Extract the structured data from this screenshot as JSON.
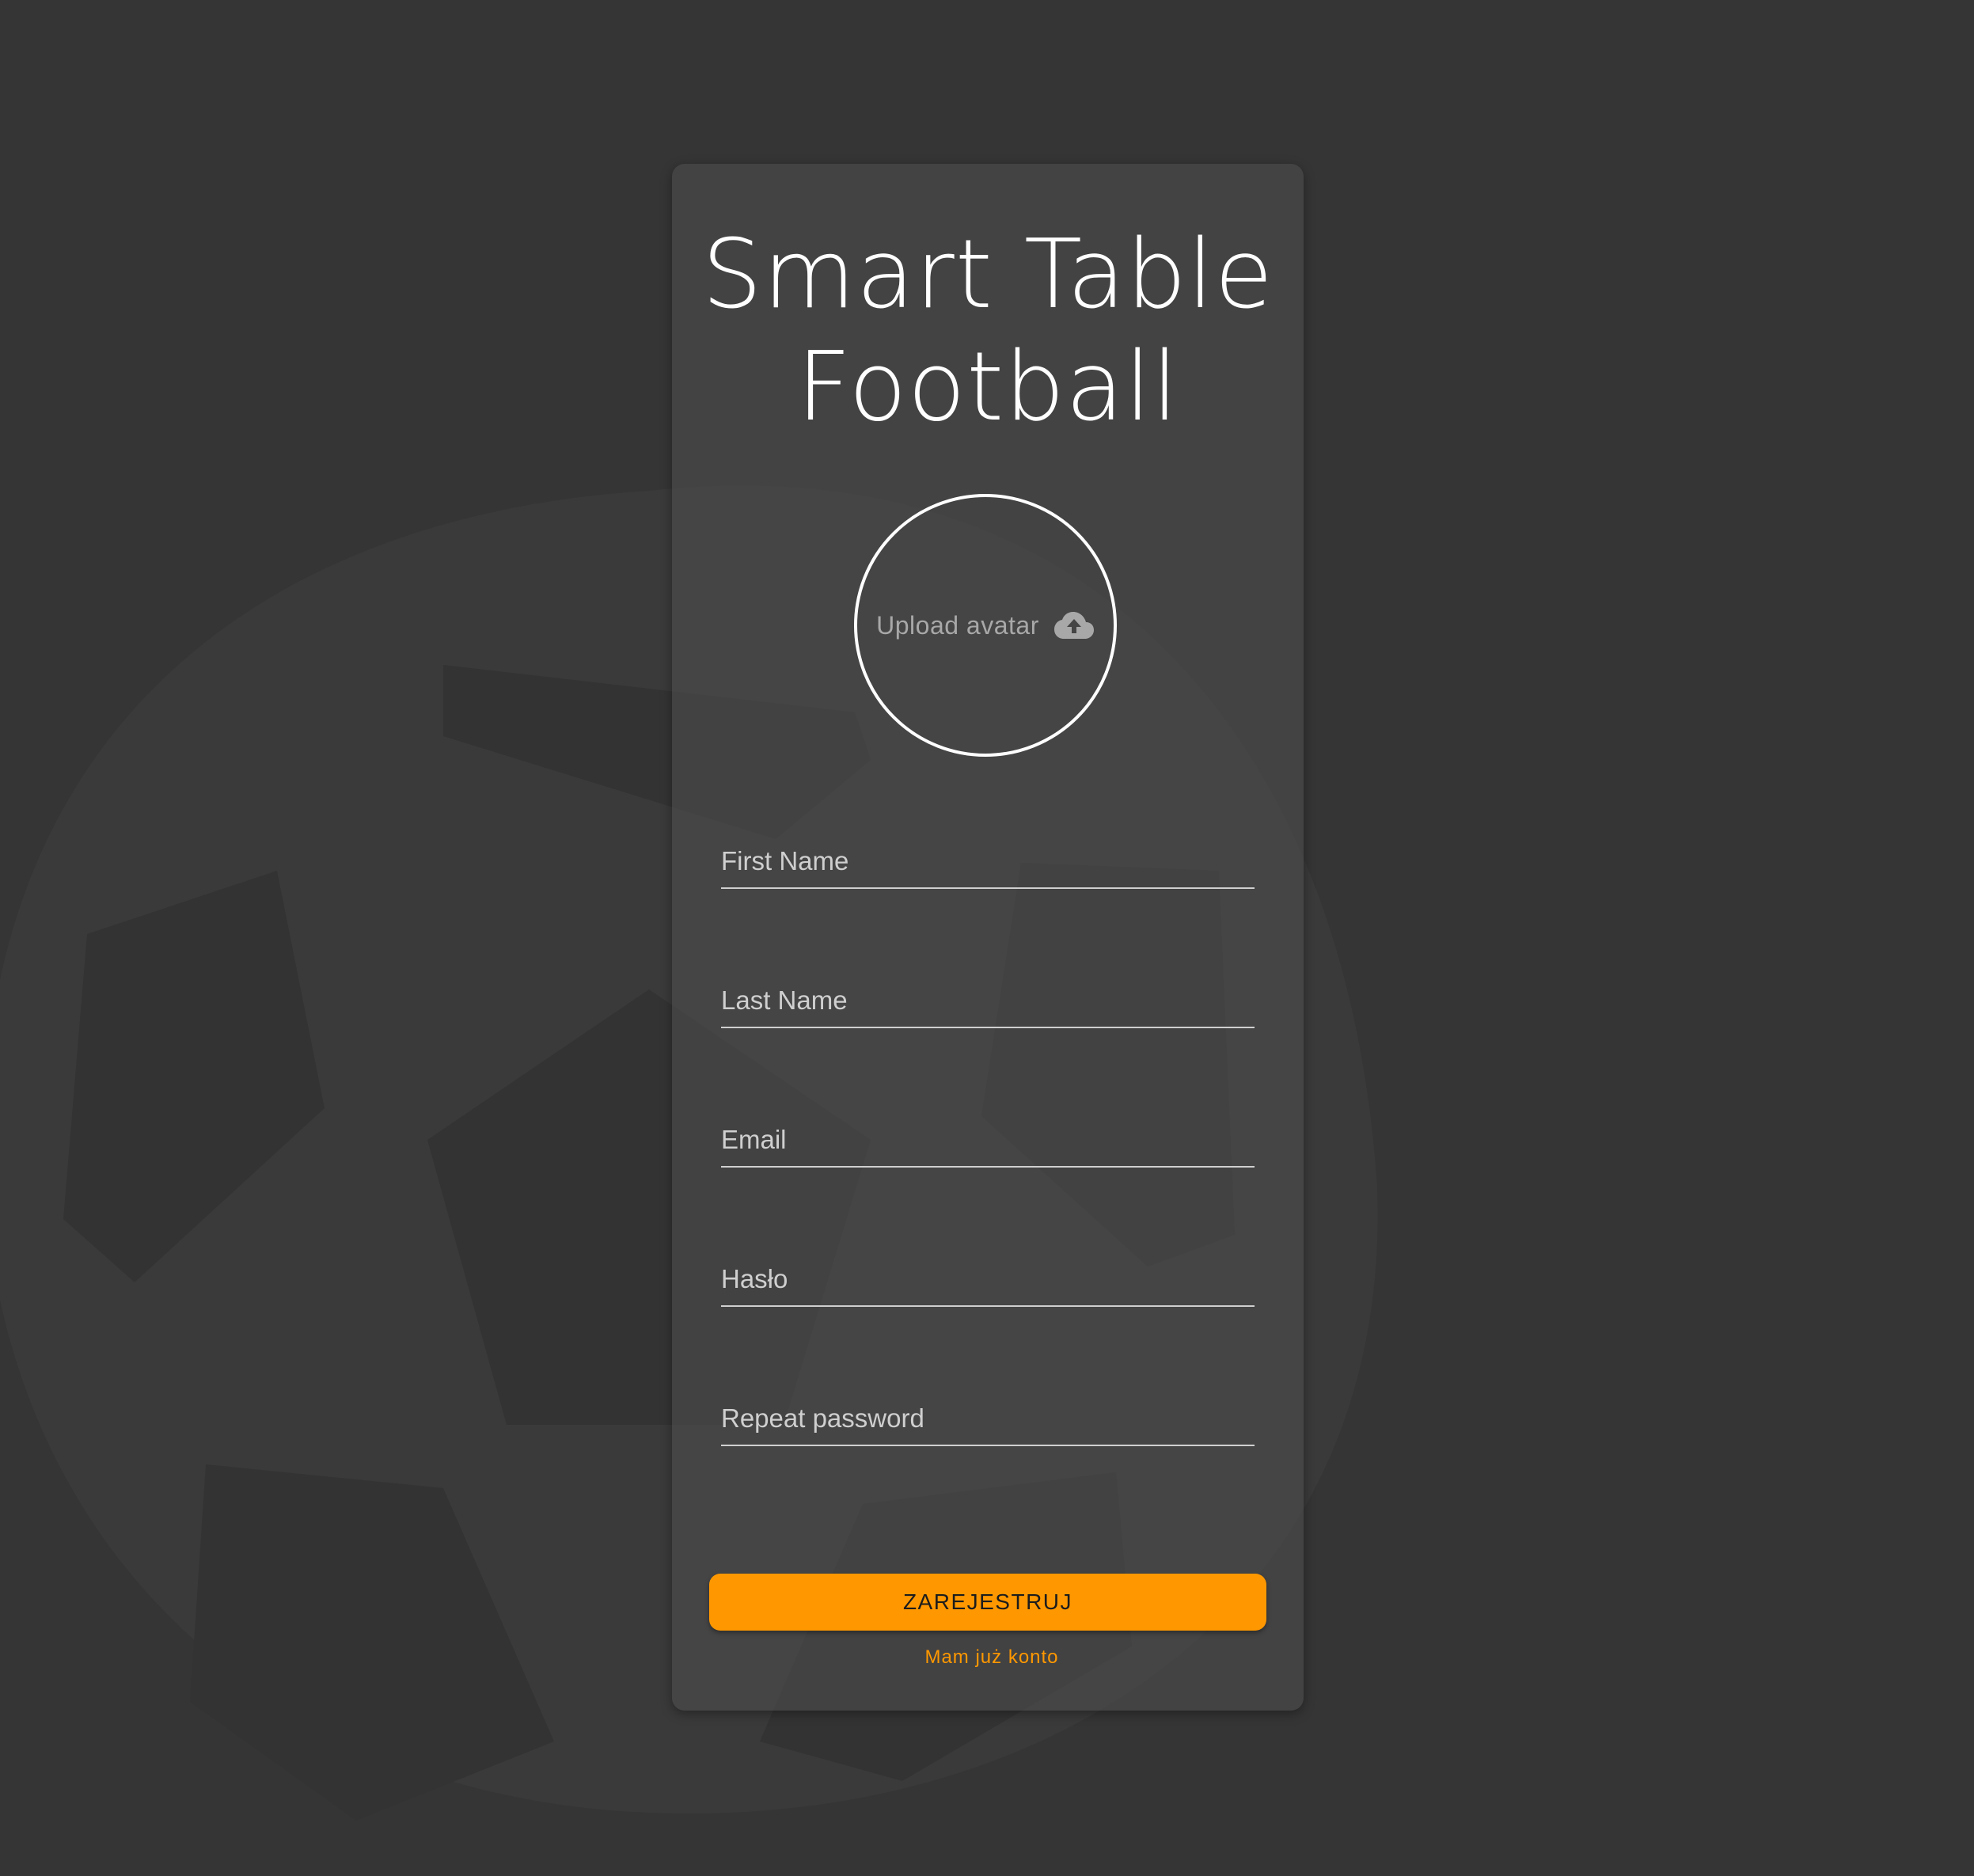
{
  "app": {
    "title_line1": "Smart Table",
    "title_line2": "Football"
  },
  "avatar": {
    "label": "Upload avatar",
    "icon": "cloud-upload-icon"
  },
  "form": {
    "first_name_placeholder": "First Name",
    "last_name_placeholder": "Last Name",
    "email_placeholder": "Email",
    "password_placeholder": "Hasło",
    "repeat_password_placeholder": "Repeat password",
    "first_name_value": "",
    "last_name_value": "",
    "email_value": "",
    "password_value": "",
    "repeat_password_value": ""
  },
  "actions": {
    "register_label": "ZAREJESTRUJ",
    "login_link_label": "Mam już konto"
  },
  "colors": {
    "background": "#353535",
    "accent": "#ff9800",
    "card": "#454545",
    "text": "#ffffff"
  }
}
